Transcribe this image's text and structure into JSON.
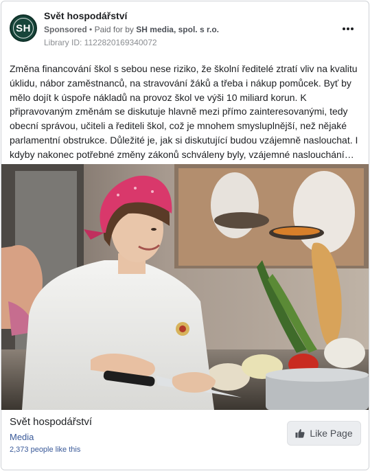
{
  "post": {
    "page_name": "Svět hospodářství",
    "avatar_initials": "SH",
    "sponsored_label": "Sponsored",
    "separator": "•",
    "paid_for_by_label": "Paid for by",
    "advertiser": "SH media, spol. s r.o.",
    "library_id": "Library ID: 1122820169340072",
    "more_icon": "more-horizontal-icon",
    "body_text": "Změna financování škol s sebou nese riziko, že školní ředitelé ztratí vliv na kvalitu úklidu, nábor zaměstnanců, na stravování žáků a třeba i nákup pomůcek. Byť by mělo dojít k úspoře nákladů na provoz škol ve výši 10 miliard korun. K připravovaným změnám se diskutuje hlavně mezi přímo zainteresovanými, tedy obecní správou, učiteli a řediteli škol, což je mnohem smysluplnější, než nějaké parlamentní obstrukce. Důležité je, jak si diskutující budou vzájemně naslouchat. I kdyby nakonec potřebné změny zákonů schváleny byly, vzájemné naslouchání…"
  },
  "footer": {
    "title": "Svět hospodářství",
    "category": "Media",
    "likes": "2,373 people like this",
    "like_button_label": "Like Page",
    "like_icon": "thumbs-up-icon"
  },
  "colors": {
    "avatar_bg": "#17453a",
    "link": "#385898",
    "button_bg": "#ebedf0"
  }
}
